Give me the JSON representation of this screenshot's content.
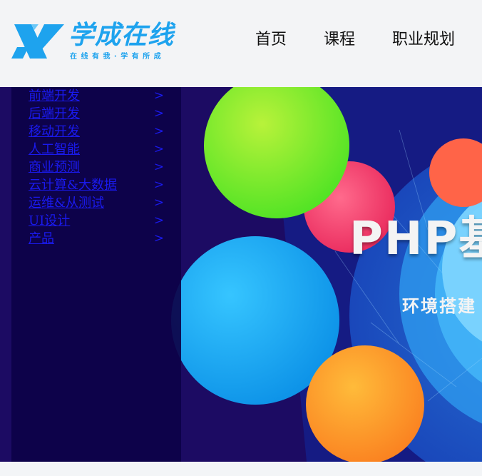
{
  "logo": {
    "title": "学成在线",
    "tagline": "在 线 有 我 · 学 有 所 成"
  },
  "nav": [
    {
      "label": "首页"
    },
    {
      "label": "课程"
    },
    {
      "label": "职业规划"
    }
  ],
  "categories": [
    {
      "label": "前端开发",
      "arrow": ">"
    },
    {
      "label": "后端开发",
      "arrow": ">"
    },
    {
      "label": "移动开发",
      "arrow": ">"
    },
    {
      "label": "人工智能",
      "arrow": ">"
    },
    {
      "label": "商业预测",
      "arrow": ">"
    },
    {
      "label": "云计算&大数据",
      "arrow": ">"
    },
    {
      "label": "运维&从测试",
      "arrow": ">"
    },
    {
      "label": "UI设计",
      "arrow": ">"
    },
    {
      "label": "产品",
      "arrow": ">"
    }
  ],
  "banner": {
    "headline": "PHP基",
    "subline": "环境搭建"
  },
  "colors": {
    "brand": "#1ea3ee",
    "banner_bg": "#1c0b63",
    "link": "#1a1aee"
  }
}
